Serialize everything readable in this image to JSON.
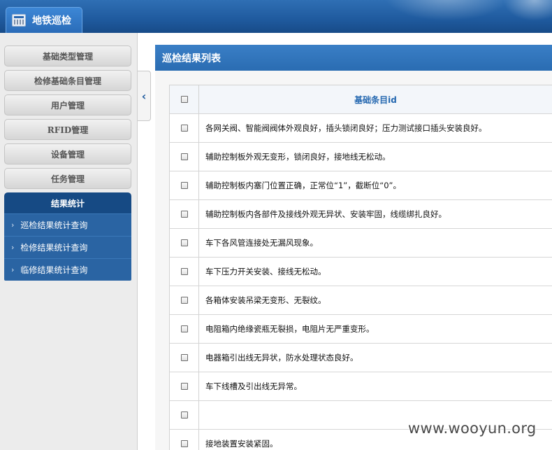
{
  "app": {
    "title": "地铁巡检"
  },
  "sidebar": {
    "buttons": [
      {
        "label": "基础类型管理"
      },
      {
        "label": "检修基础条目管理"
      },
      {
        "label": "用户管理"
      },
      {
        "label": "RFID管理"
      },
      {
        "label": "设备管理"
      },
      {
        "label": "任务管理"
      }
    ],
    "active_group": "结果统计",
    "sub_items": [
      {
        "label": "巡检结果统计查询"
      },
      {
        "label": "检修结果统计查询"
      },
      {
        "label": "临修结果统计查询"
      }
    ]
  },
  "panel": {
    "title": "巡检结果列表"
  },
  "table": {
    "header": "基础条目id",
    "rows": [
      "各网关阀、智能阀阀体外观良好，插头锁闭良好；压力测试接口插头安装良好。",
      "辅助控制板外观无变形，锁闭良好，接地线无松动。",
      "辅助控制板内塞门位置正确，正常位“1”，截断位“0”。",
      "辅助控制板内各部件及接线外观无异状、安装牢固，线缆绑扎良好。",
      "车下各风管连接处无漏风现象。",
      "车下压力开关安装、接线无松动。",
      "各箱体安装吊梁无变形、无裂纹。",
      "电阻箱内绝缘瓷瓶无裂损，电阻片无严重变形。",
      "电器箱引出线无异状，防水处理状态良好。",
      "车下线槽及引出线无异常。",
      "",
      "接地装置安装紧固。"
    ]
  },
  "watermark": "www.wooyun.org",
  "icons": {
    "collapse": "chevron-left-icon",
    "app": "calendar-icon"
  }
}
